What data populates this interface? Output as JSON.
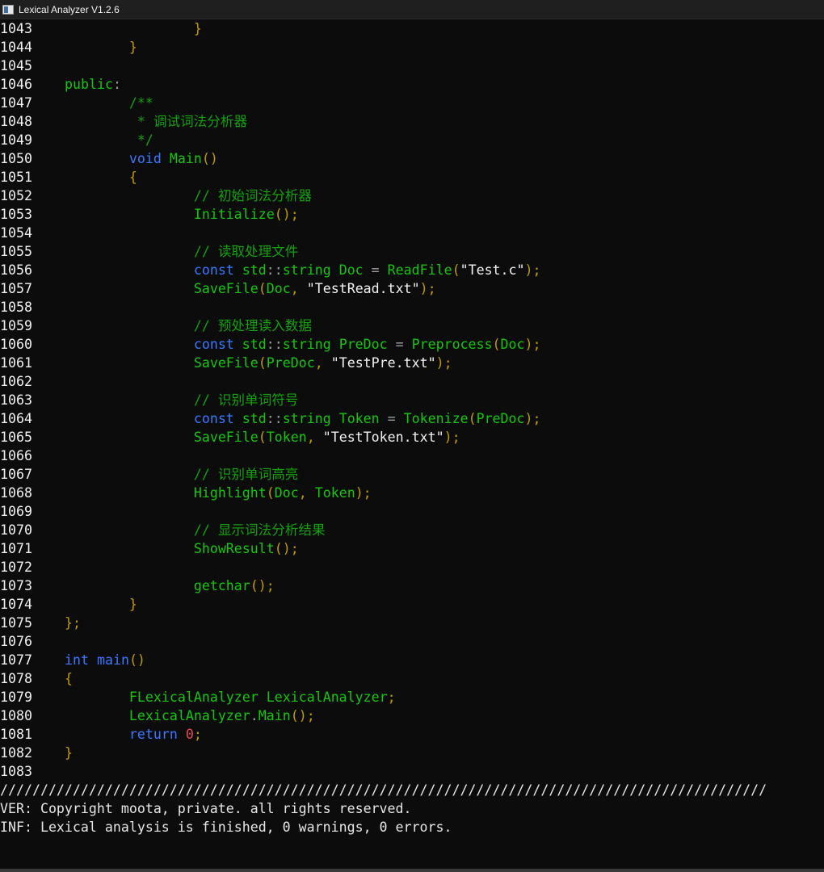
{
  "window": {
    "title": "Lexical Analyzer V1.2.6",
    "icon": "console-window-icon"
  },
  "code_lines": [
    {
      "n": "1043",
      "tokens": [
        {
          "t": "                }",
          "c": "br"
        }
      ]
    },
    {
      "n": "1044",
      "tokens": [
        {
          "t": "        }",
          "c": "br"
        }
      ]
    },
    {
      "n": "1045",
      "tokens": []
    },
    {
      "n": "1046",
      "tokens": [
        {
          "t": "public",
          "c": "id"
        },
        {
          "t": ":",
          "c": "op"
        }
      ]
    },
    {
      "n": "1047",
      "tokens": [
        {
          "t": "        /**",
          "c": "cmt"
        }
      ]
    },
    {
      "n": "1048",
      "tokens": [
        {
          "t": "         * 调试词法分析器",
          "c": "cmt"
        }
      ]
    },
    {
      "n": "1049",
      "tokens": [
        {
          "t": "         */",
          "c": "cmt"
        }
      ]
    },
    {
      "n": "1050",
      "tokens": [
        {
          "t": "        void ",
          "c": "kw"
        },
        {
          "t": "Main",
          "c": "id"
        },
        {
          "t": "()",
          "c": "br"
        }
      ]
    },
    {
      "n": "1051",
      "tokens": [
        {
          "t": "        {",
          "c": "br"
        }
      ]
    },
    {
      "n": "1052",
      "tokens": [
        {
          "t": "                // 初始词法分析器",
          "c": "cmt"
        }
      ]
    },
    {
      "n": "1053",
      "tokens": [
        {
          "t": "                Initialize",
          "c": "id"
        },
        {
          "t": "()",
          "c": "br"
        },
        {
          "t": ";",
          "c": "br"
        }
      ]
    },
    {
      "n": "1054",
      "tokens": []
    },
    {
      "n": "1055",
      "tokens": [
        {
          "t": "                // 读取处理文件",
          "c": "cmt"
        }
      ]
    },
    {
      "n": "1056",
      "tokens": [
        {
          "t": "                const ",
          "c": "kw"
        },
        {
          "t": "std",
          "c": "id"
        },
        {
          "t": "::",
          "c": "op"
        },
        {
          "t": "string ",
          "c": "id"
        },
        {
          "t": "Doc ",
          "c": "id"
        },
        {
          "t": "= ",
          "c": "op"
        },
        {
          "t": "ReadFile",
          "c": "id"
        },
        {
          "t": "(",
          "c": "br"
        },
        {
          "t": "\"Test.c\"",
          "c": "str"
        },
        {
          "t": ");",
          "c": "br"
        }
      ]
    },
    {
      "n": "1057",
      "tokens": [
        {
          "t": "                SaveFile",
          "c": "id"
        },
        {
          "t": "(",
          "c": "br"
        },
        {
          "t": "Doc",
          "c": "id"
        },
        {
          "t": ", ",
          "c": "br"
        },
        {
          "t": "\"TestRead.txt\"",
          "c": "str"
        },
        {
          "t": ");",
          "c": "br"
        }
      ]
    },
    {
      "n": "1058",
      "tokens": []
    },
    {
      "n": "1059",
      "tokens": [
        {
          "t": "                // 预处理读入数据",
          "c": "cmt"
        }
      ]
    },
    {
      "n": "1060",
      "tokens": [
        {
          "t": "                const ",
          "c": "kw"
        },
        {
          "t": "std",
          "c": "id"
        },
        {
          "t": "::",
          "c": "op"
        },
        {
          "t": "string ",
          "c": "id"
        },
        {
          "t": "PreDoc ",
          "c": "id"
        },
        {
          "t": "= ",
          "c": "op"
        },
        {
          "t": "Preprocess",
          "c": "id"
        },
        {
          "t": "(",
          "c": "br"
        },
        {
          "t": "Doc",
          "c": "id"
        },
        {
          "t": ");",
          "c": "br"
        }
      ]
    },
    {
      "n": "1061",
      "tokens": [
        {
          "t": "                SaveFile",
          "c": "id"
        },
        {
          "t": "(",
          "c": "br"
        },
        {
          "t": "PreDoc",
          "c": "id"
        },
        {
          "t": ", ",
          "c": "br"
        },
        {
          "t": "\"TestPre.txt\"",
          "c": "str"
        },
        {
          "t": ");",
          "c": "br"
        }
      ]
    },
    {
      "n": "1062",
      "tokens": []
    },
    {
      "n": "1063",
      "tokens": [
        {
          "t": "                // 识别单词符号",
          "c": "cmt"
        }
      ]
    },
    {
      "n": "1064",
      "tokens": [
        {
          "t": "                const ",
          "c": "kw"
        },
        {
          "t": "std",
          "c": "id"
        },
        {
          "t": "::",
          "c": "op"
        },
        {
          "t": "string ",
          "c": "id"
        },
        {
          "t": "Token ",
          "c": "id"
        },
        {
          "t": "= ",
          "c": "op"
        },
        {
          "t": "Tokenize",
          "c": "id"
        },
        {
          "t": "(",
          "c": "br"
        },
        {
          "t": "PreDoc",
          "c": "id"
        },
        {
          "t": ");",
          "c": "br"
        }
      ]
    },
    {
      "n": "1065",
      "tokens": [
        {
          "t": "                SaveFile",
          "c": "id"
        },
        {
          "t": "(",
          "c": "br"
        },
        {
          "t": "Token",
          "c": "id"
        },
        {
          "t": ", ",
          "c": "br"
        },
        {
          "t": "\"TestToken.txt\"",
          "c": "str"
        },
        {
          "t": ");",
          "c": "br"
        }
      ]
    },
    {
      "n": "1066",
      "tokens": []
    },
    {
      "n": "1067",
      "tokens": [
        {
          "t": "                // 识别单词高亮",
          "c": "cmt"
        }
      ]
    },
    {
      "n": "1068",
      "tokens": [
        {
          "t": "                Highlight",
          "c": "id"
        },
        {
          "t": "(",
          "c": "br"
        },
        {
          "t": "Doc",
          "c": "id"
        },
        {
          "t": ", ",
          "c": "br"
        },
        {
          "t": "Token",
          "c": "id"
        },
        {
          "t": ");",
          "c": "br"
        }
      ]
    },
    {
      "n": "1069",
      "tokens": []
    },
    {
      "n": "1070",
      "tokens": [
        {
          "t": "                // 显示词法分析结果",
          "c": "cmt"
        }
      ]
    },
    {
      "n": "1071",
      "tokens": [
        {
          "t": "                ShowResult",
          "c": "id"
        },
        {
          "t": "();",
          "c": "br"
        }
      ]
    },
    {
      "n": "1072",
      "tokens": []
    },
    {
      "n": "1073",
      "tokens": [
        {
          "t": "                getchar",
          "c": "id"
        },
        {
          "t": "();",
          "c": "br"
        }
      ]
    },
    {
      "n": "1074",
      "tokens": [
        {
          "t": "        }",
          "c": "br"
        }
      ]
    },
    {
      "n": "1075",
      "tokens": [
        {
          "t": "};",
          "c": "br"
        }
      ]
    },
    {
      "n": "1076",
      "tokens": []
    },
    {
      "n": "1077",
      "tokens": [
        {
          "t": "int ",
          "c": "kw"
        },
        {
          "t": "main",
          "c": "kw"
        },
        {
          "t": "()",
          "c": "br"
        }
      ]
    },
    {
      "n": "1078",
      "tokens": [
        {
          "t": "{",
          "c": "br"
        }
      ]
    },
    {
      "n": "1079",
      "tokens": [
        {
          "t": "        FLexicalAnalyzer ",
          "c": "id"
        },
        {
          "t": "LexicalAnalyzer",
          "c": "id"
        },
        {
          "t": ";",
          "c": "br"
        }
      ]
    },
    {
      "n": "1080",
      "tokens": [
        {
          "t": "        LexicalAnalyzer",
          "c": "id"
        },
        {
          "t": ".",
          "c": "op"
        },
        {
          "t": "Main",
          "c": "id"
        },
        {
          "t": "();",
          "c": "br"
        }
      ]
    },
    {
      "n": "1081",
      "tokens": [
        {
          "t": "        return ",
          "c": "kw"
        },
        {
          "t": "0",
          "c": "num"
        },
        {
          "t": ";",
          "c": "br"
        }
      ]
    },
    {
      "n": "1082",
      "tokens": [
        {
          "t": "}",
          "c": "br"
        }
      ]
    },
    {
      "n": "1083",
      "tokens": []
    }
  ],
  "footer": {
    "separator": "///////////////////////////////////////////////////////////////////////////////////////////////",
    "version_line": "VER: Copyright moota, private. all rights reserved.",
    "info_line": "INF: Lexical analysis is finished, 0 warnings, 0 errors."
  }
}
